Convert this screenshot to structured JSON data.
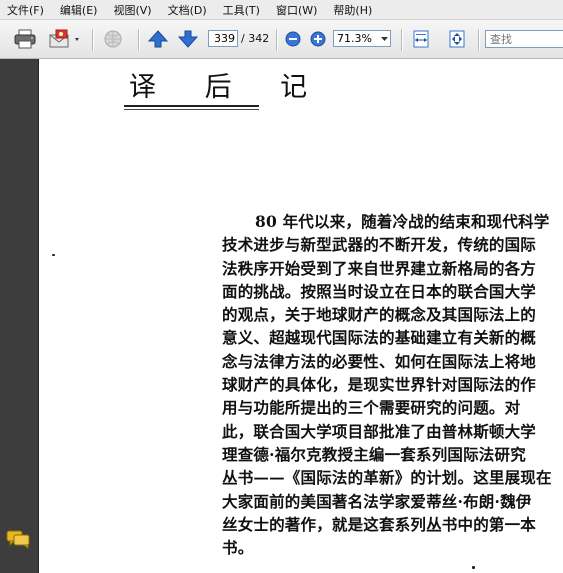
{
  "menu": [
    "文件(F)",
    "编辑(E)",
    "视图(V)",
    "文档(D)",
    "工具(T)",
    "窗口(W)",
    "帮助(H)"
  ],
  "toolbar": {
    "current_page": "339",
    "page_total": "/ 342",
    "zoom": "71.3%",
    "search_placeholder": "查找"
  },
  "document": {
    "title": "译 后 记",
    "lines": [
      "80 年代以来，随着冷战的结束和现代科学",
      "技术进步与新型武器的不断开发，传统的国际",
      "法秩序开始受到了来自世界建立新格局的各方",
      "面的挑战。按照当时设立在日本的联合国大学",
      "的观点，关于地球财产的概念及其国际法上的",
      "意义、超越现代国际法的基础建立有关新的概",
      "念与法律方法的必要性、如何在国际法上将地",
      "球财产的具体化，是现实世界针对国际法的作",
      "用与功能所提出的三个需要研究的问题。对",
      "此，联合国大学项目部批准了由普林斯顿大学",
      "理查德·福尔克教授主编一套系列国际法研究",
      "丛书——《国际法的革新》的计划。这里展现在",
      "大家面前的美国著名法学家爱蒂丝·布朗·魏伊",
      "丝女士的著作，就是这套系列丛书中的第一本",
      "书。"
    ]
  },
  "colors": {
    "toolbar_bg": "#ececec",
    "nav_pane": "#3d3d3d",
    "arrow_blue": "#2f6fd0",
    "zoom_blue": "#3a74d6"
  }
}
